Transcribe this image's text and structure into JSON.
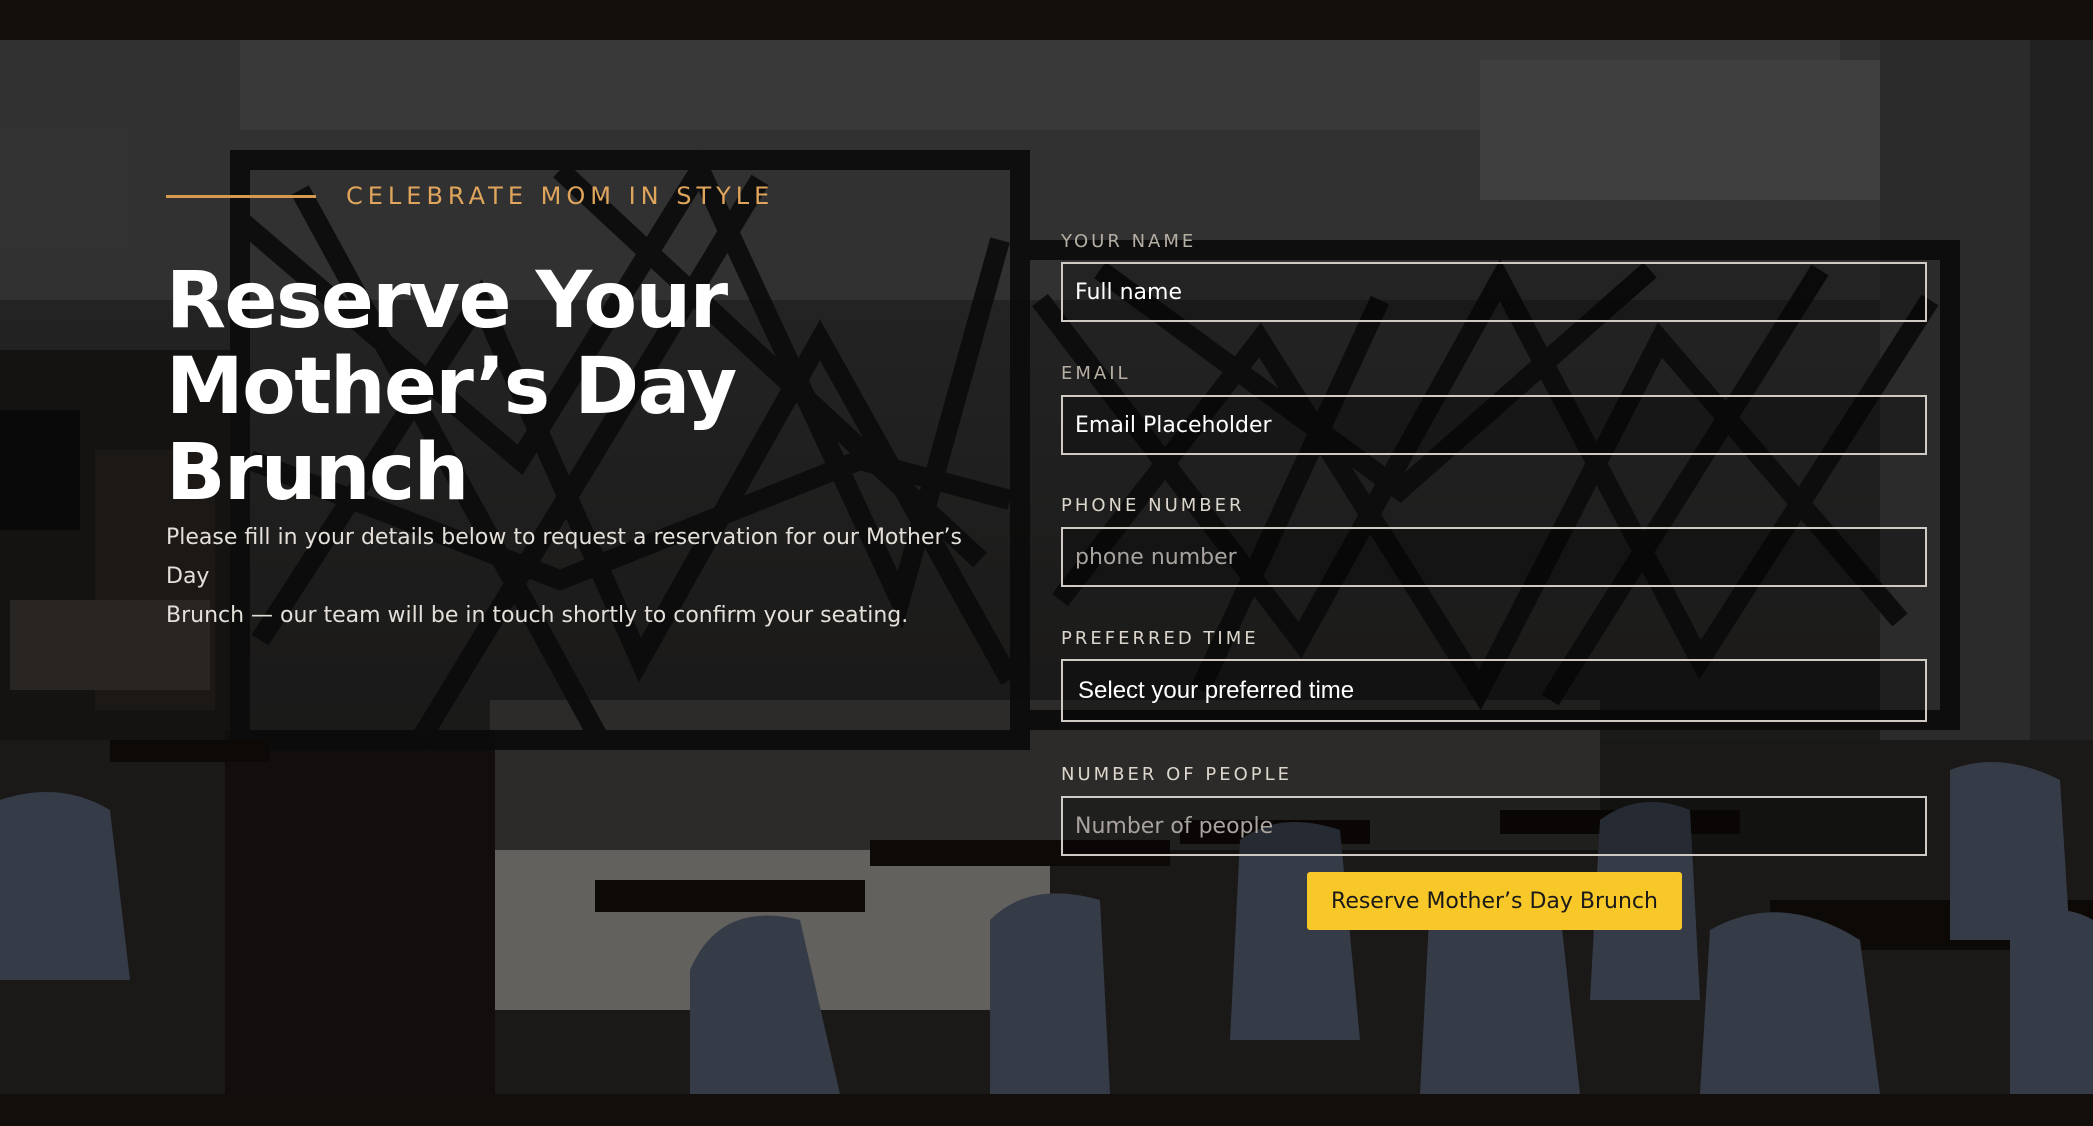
{
  "hero": {
    "eyebrow": "CELEBRATE MOM IN STYLE",
    "title_line1": "Reserve Your",
    "title_line2": "Mother’s Day Brunch",
    "intro_line1": "Please fill in your details below to request a reservation for our Mother’s Day",
    "intro_line2": "Brunch — our team will be in touch shortly to confirm your seating."
  },
  "form": {
    "name": {
      "label": "YOUR NAME",
      "value": "Full name"
    },
    "email": {
      "label": "EMAIL",
      "value": "Email Placeholder"
    },
    "phone": {
      "label": "PHONE NUMBER",
      "placeholder": "phone number"
    },
    "time": {
      "label": "PREFERRED TIME",
      "value": "Select your preferred time"
    },
    "people": {
      "label": "NUMBER OF PEOPLE",
      "placeholder": "Number of people"
    },
    "submit_label": "Reserve Mother’s Day Brunch"
  },
  "colors": {
    "accent_gold": "#e0a55c",
    "button_yellow": "#f8c828",
    "page_dark": "#110e0b"
  }
}
